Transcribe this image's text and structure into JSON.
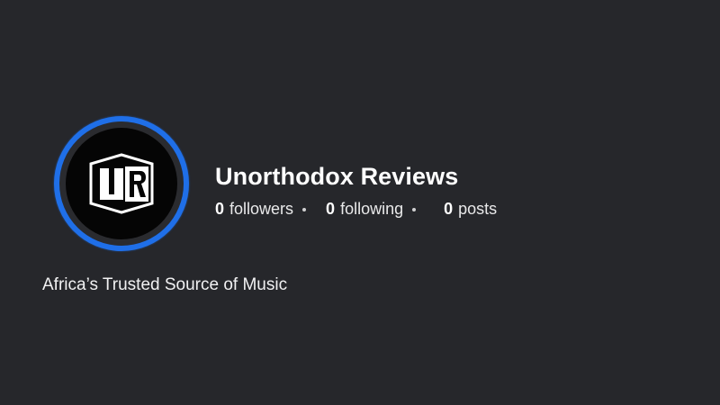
{
  "profile": {
    "name": "Unorthodox Reviews",
    "avatar_icon": "ur-logo-icon",
    "avatar_logo_text": "UR",
    "ring_color": "#1f6fe8",
    "stats": {
      "followers": {
        "count": "0",
        "label": "followers"
      },
      "following": {
        "count": "0",
        "label": "following"
      },
      "posts": {
        "count": "0",
        "label": "posts"
      }
    },
    "bio": "Africa’s Trusted Source of Music"
  }
}
